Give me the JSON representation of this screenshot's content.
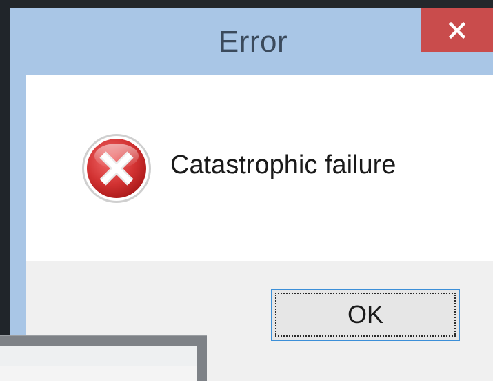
{
  "dialog": {
    "title": "Error",
    "close_icon": "close-icon",
    "message": "Catastrophic failure",
    "icon": "error-icon",
    "ok_label": "OK"
  },
  "colors": {
    "titlebar": "#a9c6e6",
    "close_button": "#c94c4c",
    "content_background": "#ffffff",
    "button_area": "#f0f0f0",
    "ok_border": "#3c8fd8"
  }
}
